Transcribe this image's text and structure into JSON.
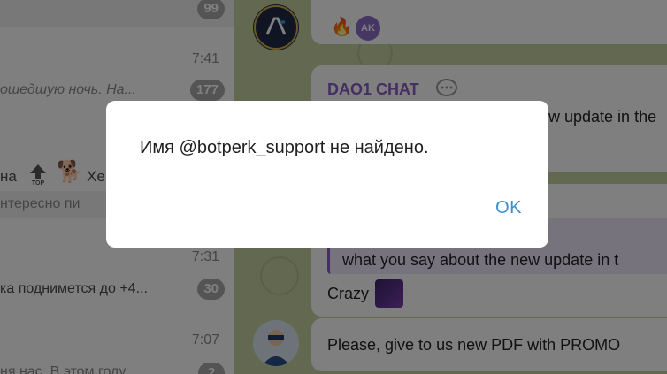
{
  "chat_list": {
    "rows": [
      {
        "time": "",
        "preview": "",
        "badge": "99"
      },
      {
        "time": "7:41",
        "preview": "ошедшую ночь. На...",
        "badge": "177"
      },
      {
        "time": "",
        "preview": "на",
        "extra": "Хе",
        "badge": ""
      },
      {
        "time": "",
        "preview": "нтересно пи",
        "badge": ""
      },
      {
        "time": "7:31",
        "preview": "ка поднимется до +4...",
        "badge": "30"
      },
      {
        "time": "7:07",
        "preview": "ня нас. В этом году",
        "badge": "2"
      }
    ]
  },
  "chat": {
    "reactions": {
      "fire": "🔥",
      "avatar_initials": "AK"
    },
    "message1": {
      "sender": "DAO1 CHAT",
      "text_visible": "w update in the"
    },
    "message2": {
      "quote_text": "what you say about the new update in t",
      "text": "Crazy"
    },
    "message3": {
      "text": "Please, give to us new PDF with PROMO"
    },
    "colors": {
      "accent_purple": "#8a5cc2",
      "wallpaper": "#c7d3a2"
    }
  },
  "dialog": {
    "message": "Имя @botperk_support не найдено.",
    "ok_label": "OK",
    "accent": "#3a8fcf"
  }
}
